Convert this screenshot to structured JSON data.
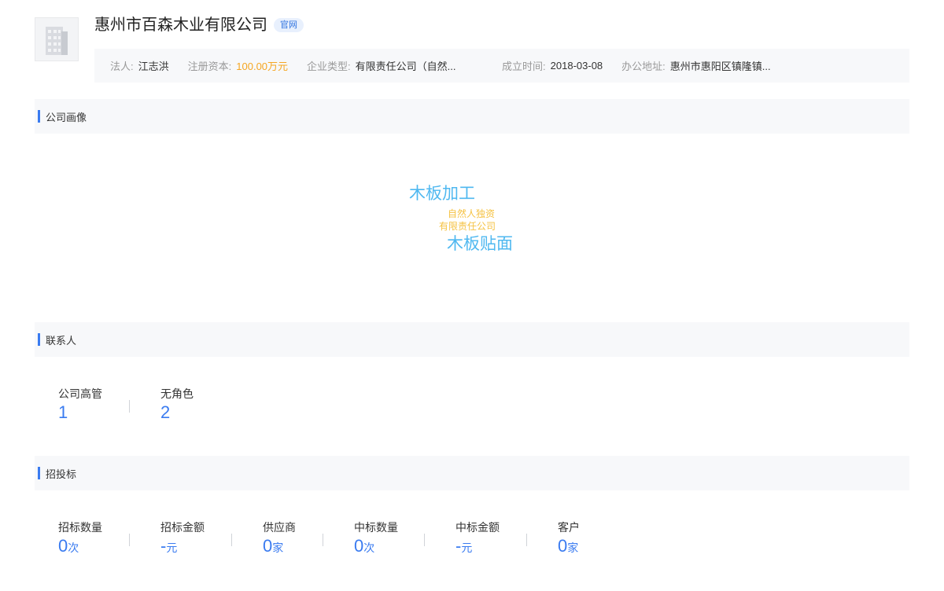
{
  "company": {
    "name": "惠州市百森木业有限公司",
    "official_badge": "官网",
    "logo_icon": "building-icon"
  },
  "info": {
    "legal_person_label": "法人:",
    "legal_person": "江志洪",
    "capital_label": "注册资本:",
    "capital": "100.00万元",
    "type_label": "企业类型:",
    "type": "有限责任公司（自然...",
    "founded_label": "成立时间:",
    "founded": "2018-03-08",
    "address_label": "办公地址:",
    "address": "惠州市惠阳区镇隆镇..."
  },
  "sections": {
    "portrait": "公司画像",
    "contacts": "联系人",
    "bidding": "招投标"
  },
  "word_cloud": [
    {
      "text": "木板加工",
      "color": "#4fb8f0"
    },
    {
      "text": "自然人独资",
      "color": "#f5c242"
    },
    {
      "text": "有限责任公司",
      "color": "#f5c242"
    },
    {
      "text": "木板贴面",
      "color": "#4fb8f0"
    }
  ],
  "contacts": [
    {
      "label": "公司高管",
      "value": "1"
    },
    {
      "label": "无角色",
      "value": "2"
    }
  ],
  "bidding": [
    {
      "label": "招标数量",
      "value": "0",
      "unit": "次"
    },
    {
      "label": "招标金额",
      "value": "-",
      "unit": "元"
    },
    {
      "label": "供应商",
      "value": "0",
      "unit": "家"
    },
    {
      "label": "中标数量",
      "value": "0",
      "unit": "次"
    },
    {
      "label": "中标金额",
      "value": "-",
      "unit": "元"
    },
    {
      "label": "客户",
      "value": "0",
      "unit": "家"
    }
  ],
  "colors": {
    "accent": "#3a7bf0",
    "capital": "#f5a623",
    "cloud_blue": "#4fb8f0",
    "cloud_yellow": "#f5c242"
  }
}
